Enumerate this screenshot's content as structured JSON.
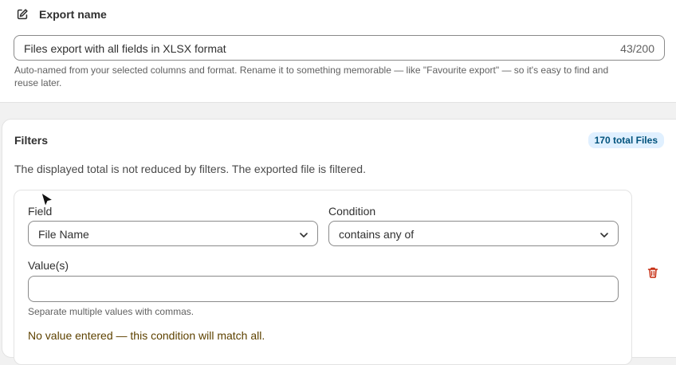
{
  "export": {
    "title": "Export name",
    "name_value": "Files export with all fields in XLSX format",
    "char_count": "43/200",
    "help_line1": "Auto-named from your selected columns and format. Rename it to something memorable — like \"Favourite export\" — so it's easy to find and",
    "help_line2": "reuse later."
  },
  "filters": {
    "title": "Filters",
    "total_badge": "170 total Files",
    "note": "The displayed total is not reduced by filters. The exported file is filtered.",
    "field_label": "Field",
    "field_value": "File Name",
    "condition_label": "Condition",
    "condition_value": "contains any of",
    "values_label": "Value(s)",
    "values_input": "",
    "values_help": "Separate multiple values with commas.",
    "warning": "No value entered — this condition will match all."
  },
  "colors": {
    "badge_bg": "#e0f0ff",
    "badge_text": "#00527c",
    "delete_icon": "#c5280c",
    "warning_text": "#5e4200"
  },
  "icons": {
    "edit": "edit-icon",
    "chevron": "chevron-down-icon",
    "delete": "trash-icon"
  }
}
